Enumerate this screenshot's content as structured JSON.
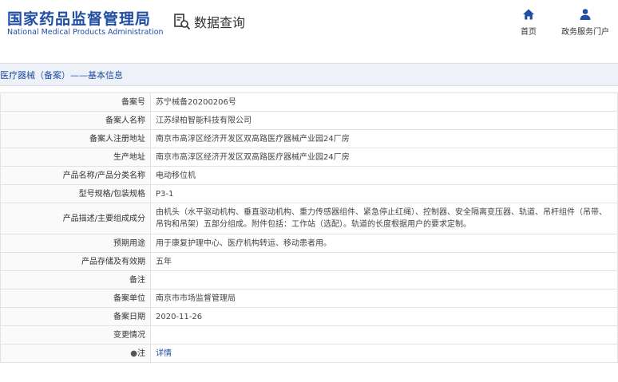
{
  "header": {
    "logo_cn": "国家药品监督管理局",
    "logo_en": "National Medical Products Administration",
    "query_label": "数据查询",
    "nav": [
      {
        "label": "首页",
        "icon": "home-icon"
      },
      {
        "label": "政务服务门户",
        "icon": "user-icon"
      }
    ]
  },
  "section_title": "医疗器械（备案）——基本信息",
  "rows": [
    {
      "label": "备案号",
      "value": "苏宁械备20200206号"
    },
    {
      "label": "备案人名称",
      "value": "江苏绿柏智能科技有限公司"
    },
    {
      "label": "备案人注册地址",
      "value": "南京市高淳区经济开发区双高路医疗器械产业园24厂房"
    },
    {
      "label": "生产地址",
      "value": "南京市高淳区经济开发区双高路医疗器械产业园24厂房"
    },
    {
      "label": "产品名称/产品分类名称",
      "value": "电动移位机"
    },
    {
      "label": "型号规格/包装规格",
      "value": "P3-1"
    },
    {
      "label": "产品描述/主要组成成分",
      "value": "由机头（水平驱动机构、垂直驱动机构、重力传感器组件、紧急停止红绳）、控制器、安全隔离变压器、轨道、吊杆组件（吊带、吊钩和吊架）五部分组成。附件包括：工作站（选配）。轨道的长度根据用户的要求定制。"
    },
    {
      "label": "预期用途",
      "value": "用于康复护理中心、医疗机构转运、移动患者用。"
    },
    {
      "label": "产品存储及有效期",
      "value": "五年"
    },
    {
      "label": "备注",
      "value": ""
    },
    {
      "label": "备案单位",
      "value": "南京市市场监督管理局"
    },
    {
      "label": "备案日期",
      "value": "2020-11-26"
    },
    {
      "label": "变更情况",
      "value": ""
    },
    {
      "label": "注",
      "value": "详情",
      "icon": "pin-icon"
    }
  ]
}
